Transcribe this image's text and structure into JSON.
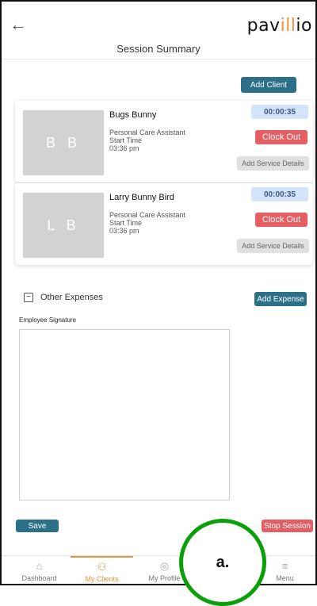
{
  "header": {
    "back_icon": "back-arrow-icon",
    "logo_prefix": "pav",
    "logo_accent": "ill",
    "logo_suffix": "io",
    "title": "Session Summary"
  },
  "actions": {
    "add_client": "Add Client",
    "add_expense": "Add Expense",
    "save": "Save",
    "stop_session": "Stop Session"
  },
  "clients": [
    {
      "initials": "B B",
      "name": "Bugs Bunny",
      "role": "Personal Care Assistant",
      "start_label": "Start Time",
      "start_time": "03:36 pm",
      "timer": "00:00:35",
      "clock_out": "Clock Out",
      "add_service": "Add Service Details"
    },
    {
      "initials": "L B",
      "name": "Larry Bunny Bird",
      "role": "Personal Care Assistant",
      "start_label": "Start Time",
      "start_time": "03:36 pm",
      "timer": "00:00:35",
      "clock_out": "Clock Out",
      "add_service": "Add Service Details"
    }
  ],
  "expenses": {
    "toggle_symbol": "−",
    "label": "Other Expenses"
  },
  "signature": {
    "label": "Employee Signature"
  },
  "nav": {
    "items": [
      {
        "label": "Dashboard",
        "icon": "home-icon",
        "glyph": "⌂",
        "active": false
      },
      {
        "label": "My Clients",
        "icon": "clients-icon",
        "glyph": "⚇",
        "active": true
      },
      {
        "label": "My Profile",
        "icon": "profile-icon",
        "glyph": "◎",
        "active": false
      },
      {
        "label": "Menu",
        "icon": "menu-icon",
        "glyph": "≡",
        "active": false
      }
    ]
  },
  "annotation": {
    "label": "a."
  },
  "colors": {
    "teal": "#2b7088",
    "red": "#e45e64",
    "accent": "#e8943a",
    "timer_bg": "#d4e4fb",
    "annotation_green": "#0aa00a"
  }
}
